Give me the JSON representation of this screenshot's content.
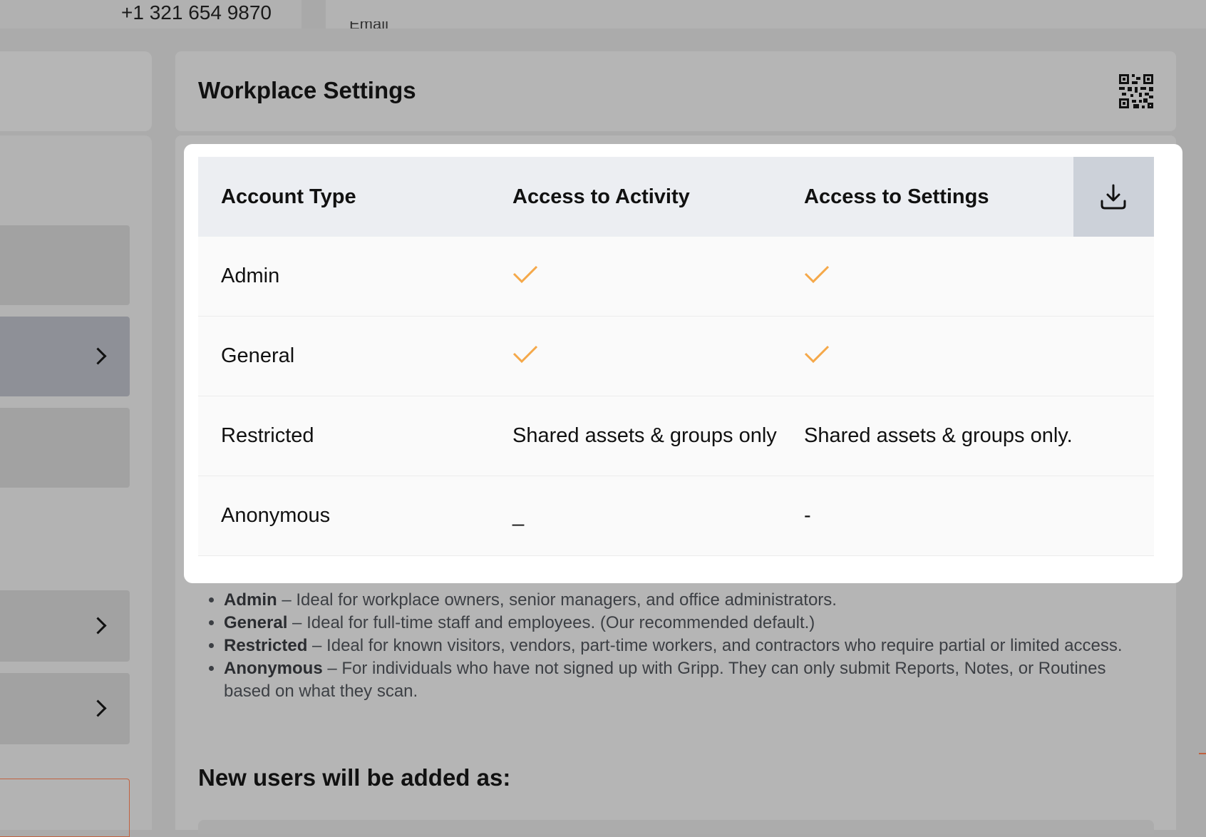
{
  "top": {
    "phone": "+1 321 654 9870",
    "cut_text": "Email"
  },
  "main": {
    "title": "Workplace Settings",
    "qr_icon": "qr-code-icon"
  },
  "table": {
    "columns": [
      "Account Type",
      "Access to Activity",
      "Access to Settings"
    ],
    "download_icon": "download-icon",
    "rows": [
      {
        "type": "Admin",
        "activity": "check",
        "settings": "check"
      },
      {
        "type": "General",
        "activity": "check",
        "settings": "check"
      },
      {
        "type": "Restricted",
        "activity": "Shared assets & groups only",
        "settings": "Shared assets & groups only."
      },
      {
        "type": "Anonymous",
        "activity": "_",
        "settings": "-"
      }
    ]
  },
  "descriptions": [
    {
      "term": "Admin",
      "text": " – Ideal for workplace owners, senior managers, and office administrators."
    },
    {
      "term": "General",
      "text": " – Ideal for full-time staff and employees. (Our recommended default.)"
    },
    {
      "term": "Restricted",
      "text": " – Ideal for known visitors, vendors, part-time workers, and contractors who require partial or limited access."
    },
    {
      "term": "Anonymous",
      "text": " – For individuals who have not signed up with Gripp. They can only submit Reports, Notes, or Routines based on what they scan."
    }
  ],
  "new_users_heading": "New users will be added as:",
  "colors": {
    "check": "#f5a849",
    "backdrop": "#ababab",
    "header_bg": "#eceef2",
    "download_bg": "#ccd1d9"
  }
}
